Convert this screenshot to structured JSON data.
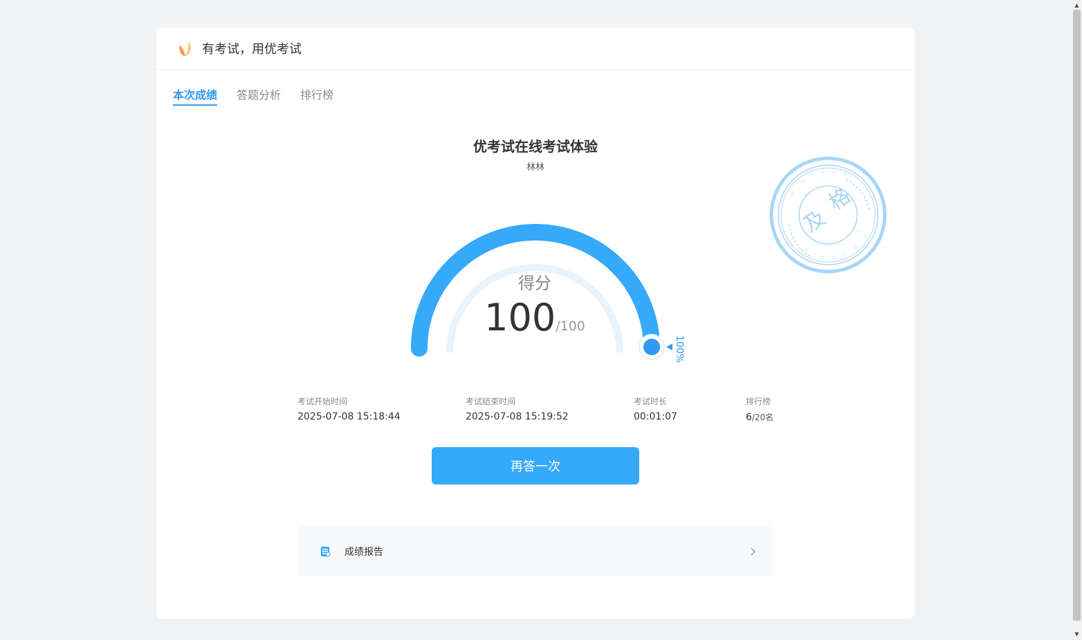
{
  "header": {
    "brand": "有考试，用优考试"
  },
  "tabs": [
    {
      "label": "本次成绩",
      "active": true
    },
    {
      "label": "答题分析",
      "active": false
    },
    {
      "label": "排行榜",
      "active": false
    }
  ],
  "exam": {
    "title": "优考试在线考试体验",
    "user": "林林"
  },
  "score": {
    "label": "得分",
    "value": "100",
    "total": "/100",
    "percent_text": "100%",
    "fraction": 1.0
  },
  "stamp": {
    "text_left": "及",
    "text_right": "格"
  },
  "stats": [
    {
      "label": "考试开始时间",
      "value": "2025-07-08 15:18:44"
    },
    {
      "label": "考试结束时间",
      "value": "2025-07-08 15:19:52"
    },
    {
      "label": "考试时长",
      "value": "00:01:07"
    },
    {
      "label": "排行榜",
      "rank": "6",
      "of": "/20名"
    }
  ],
  "retry_label": "再答一次",
  "report_label": "成绩报告",
  "colors": {
    "accent": "#2e9bf0",
    "button": "#36a9fb",
    "stamp": "#a8d6f7"
  }
}
